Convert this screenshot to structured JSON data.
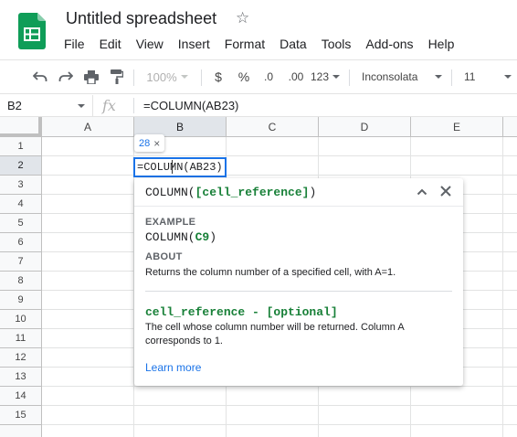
{
  "app": {
    "title": "Untitled spreadsheet",
    "menu": [
      "File",
      "Edit",
      "View",
      "Insert",
      "Format",
      "Data",
      "Tools",
      "Add-ons",
      "Help"
    ]
  },
  "toolbar": {
    "zoom": "100%",
    "currency": "$",
    "percent": "%",
    "decrease_decimals": ".0",
    "increase_decimals": ".00",
    "more_formats": "123",
    "font": "Inconsolata",
    "font_size": "11"
  },
  "formula_bar": {
    "name_box": "B2",
    "fx": "fx",
    "formula": "=COLUMN(AB23)"
  },
  "grid": {
    "columns": [
      "A",
      "B",
      "C",
      "D",
      "E"
    ],
    "rows": [
      "1",
      "2",
      "3",
      "4",
      "5",
      "6",
      "7",
      "8",
      "9",
      "10",
      "11",
      "12",
      "13",
      "14",
      "15"
    ],
    "active_cell_text": "=COLUMN(AB23)",
    "result_preview": "28",
    "result_close": "×"
  },
  "help": {
    "signature_fn": "COLUMN(",
    "signature_param": "[cell_reference]",
    "signature_close": ")",
    "example_label": "EXAMPLE",
    "example_fn": "COLUMN(",
    "example_arg": "C9",
    "example_close": ")",
    "about_label": "ABOUT",
    "about_text": "Returns the column number of a specified cell, with A=1.",
    "param_name": "cell_reference - [optional]",
    "param_desc": "The cell whose column number will be returned. Column A corresponds to 1.",
    "learn_more": "Learn more"
  },
  "colors": {
    "accent": "#1a73e8",
    "param_green": "#188038",
    "sheets_green": "#0f9d58"
  }
}
